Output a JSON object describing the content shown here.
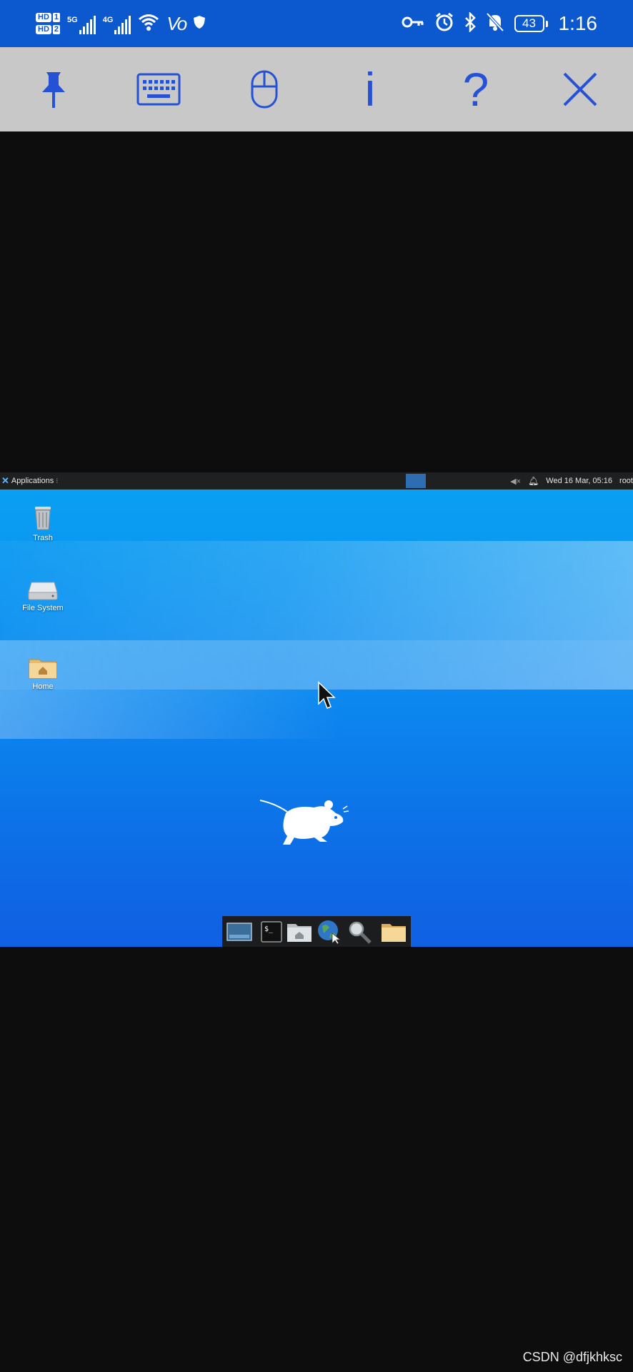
{
  "status_bar": {
    "sim1_label": "HD",
    "sim1_slot": "1",
    "sim2_label": "HD",
    "sim2_slot": "2",
    "network1": "5G",
    "network2": "4G",
    "volte": "Vo",
    "battery_level": "43",
    "time": "1:16",
    "background_color": "#0b58cf"
  },
  "remote_toolbar": {
    "background_color": "#c8c8c8",
    "icon_color": "#2451d6",
    "info_glyph": "i",
    "help_glyph": "?"
  },
  "xfce_panel": {
    "applications_label": "Applications",
    "datetime": "Wed 16 Mar, 05:16",
    "user": "root"
  },
  "desktop_icons": [
    {
      "label": "Trash"
    },
    {
      "label": "File System"
    },
    {
      "label": "Home"
    }
  ],
  "watermark": "CSDN @dfjkhksc"
}
